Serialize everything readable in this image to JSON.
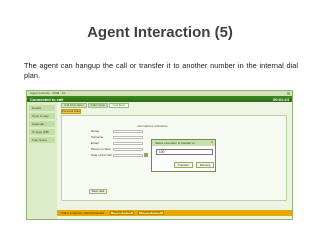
{
  "slide": {
    "title": "Agent Interaction (5)",
    "body": "The agent can hangup the call or transfer it to another number in the internal dial plan."
  },
  "app": {
    "window_title": "Agent Console - CRM - Int",
    "status_text": "Connected to call",
    "timer": "00:01:24",
    "sidebar_items": [
      "Details",
      "Tools & Help",
      "Calendar",
      "IT Apps (DB)",
      "Fran Notes"
    ],
    "tabs": [
      {
        "label": "Call Information",
        "active": false
      },
      {
        "label": "Caller Notes",
        "active": false
      },
      {
        "label": "Cust Desc",
        "active": true
      }
    ],
    "subtab_label": "Personal Data",
    "panel_heading": "Informazioni sull'utente",
    "form_fields": [
      "Name",
      "Surname",
      "Email",
      "Phone number",
      "Date of the Call"
    ],
    "save_label": "Save data",
    "bottom_bar": {
      "label": "Call in progress, Call Connected",
      "buttons": [
        "Hangup the call",
        "Transfer the call"
      ]
    },
    "dialog": {
      "title": "Select extension to transfer to",
      "value": "100",
      "transfer_label": "Transfer",
      "dismiss_label": "Dismiss"
    }
  }
}
